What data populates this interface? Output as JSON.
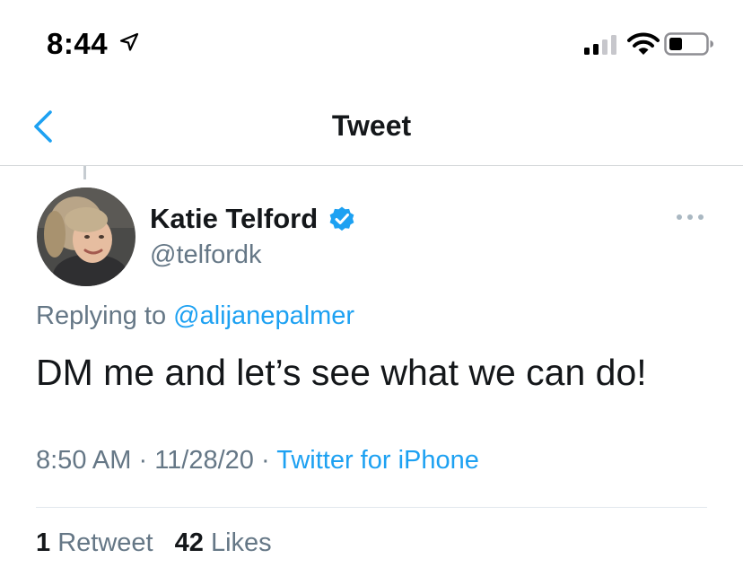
{
  "status_bar": {
    "time": "8:44",
    "icons": [
      "location-arrow-icon",
      "cellular-signal-icon",
      "wifi-icon",
      "battery-icon"
    ]
  },
  "nav": {
    "title": "Tweet",
    "back_icon": "chevron-left-icon"
  },
  "tweet": {
    "author": {
      "name": "Katie Telford",
      "handle": "@telfordk",
      "verified": true
    },
    "replying_prefix": "Replying to",
    "replying_to": "@alijanepalmer",
    "text": "DM me and let’s see what we can do!",
    "time": "8:50 AM",
    "date": "11/28/20",
    "separator": "·",
    "source": "Twitter for iPhone",
    "stats": {
      "retweets_count": "1",
      "retweets_label": "Retweet",
      "likes_count": "42",
      "likes_label": "Likes"
    }
  },
  "colors": {
    "accent": "#1da1f2",
    "text_primary": "#14171a",
    "text_secondary": "#657786",
    "divider": "#e1e8ed"
  }
}
